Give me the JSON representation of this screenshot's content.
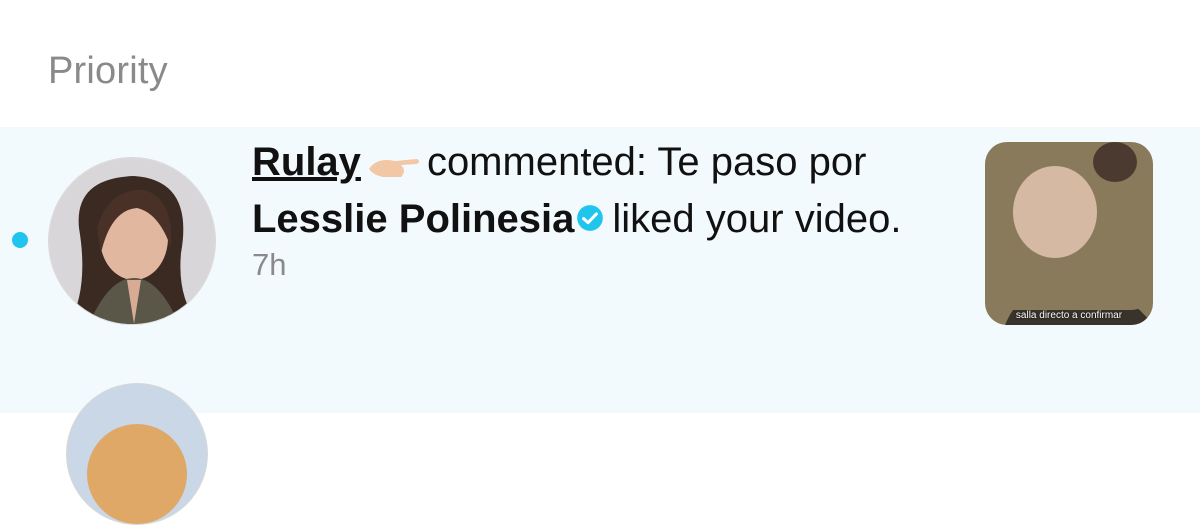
{
  "section": {
    "title": "Priority"
  },
  "notifications": [
    {
      "username": "Lesslie Polinesia",
      "verified": true,
      "action": "liked your video.",
      "time": "7h",
      "unread": true,
      "thumbnail_caption": "salla directo a confirmar"
    },
    {
      "username": "Rulay",
      "action": "commented: Te paso por"
    }
  ]
}
